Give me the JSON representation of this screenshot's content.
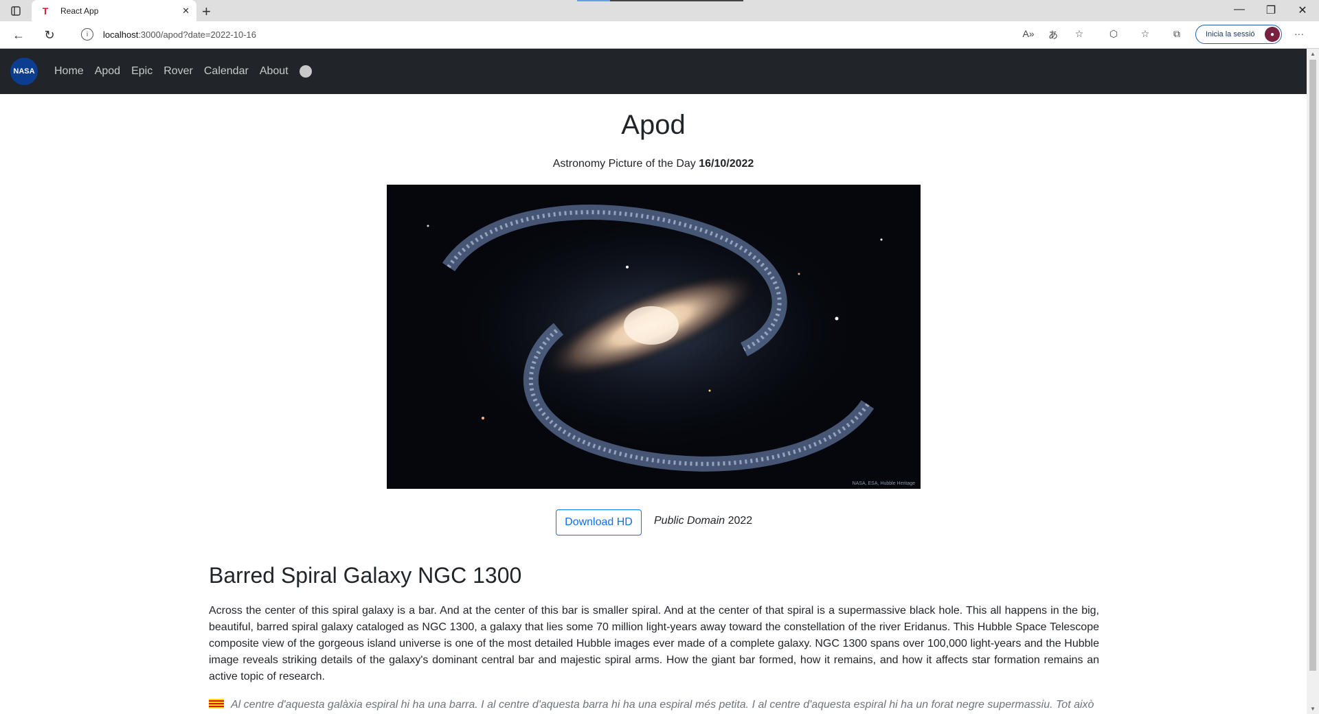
{
  "browser": {
    "tab_title": "React App",
    "url_host": "localhost",
    "url_rest": ":3000/apod?date=2022-10-16",
    "signin_label": "Inicia la sessió"
  },
  "navbar": {
    "logo_text": "NASA",
    "links": [
      "Home",
      "Apod",
      "Epic",
      "Rover",
      "Calendar",
      "About"
    ]
  },
  "page": {
    "title": "Apod",
    "subtitle": "Astronomy Picture of the Day",
    "date": "16/10/2022",
    "image_credit": "NASA, ESA, Hubble Heritage",
    "download_label": "Download HD",
    "copyright_italic": "Public Domain",
    "copyright_year": "2022",
    "article_title": "Barred Spiral Galaxy NGC 1300",
    "explanation": "Across the center of this spiral galaxy is a bar. And at the center of this bar is smaller spiral. And at the center of that spiral is a supermassive black hole.  This all happens in the big, beautiful, barred spiral galaxy cataloged as NGC 1300, a galaxy that lies some 70 million light-years away toward the constellation of the river Eridanus. This Hubble Space Telescope composite view of the gorgeous island universe is one of the most detailed Hubble images ever made of a complete galaxy. NGC 1300 spans over 100,000 light-years and the Hubble image reveals striking details of the galaxy's dominant central bar and majestic spiral arms. How the giant bar formed, how it remains, and how it affects star formation remains an active topic of research.",
    "translation": "Al centre d'aquesta galàxia espiral hi ha una barra. I al centre d'aquesta barra hi ha una espiral més petita. I al centre d'aquesta espiral hi ha un forat negre supermassiu. Tot això"
  }
}
